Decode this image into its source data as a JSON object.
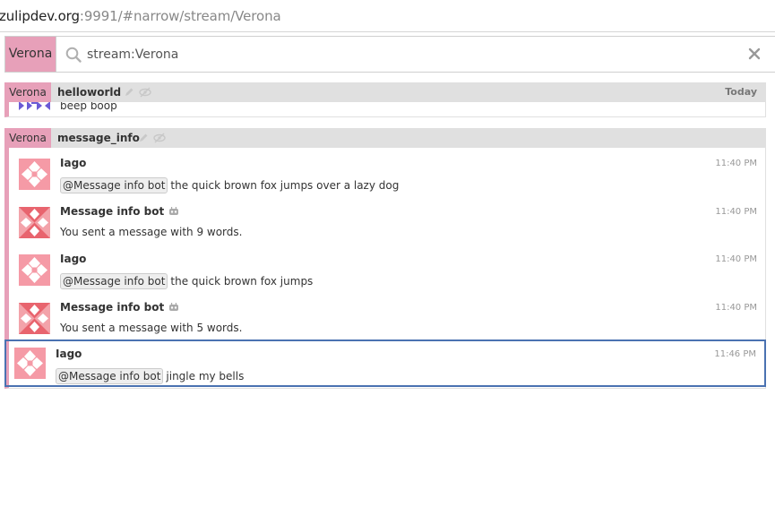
{
  "browser": {
    "url_host": "zulipdev.org",
    "url_rest": ":9991/#narrow/stream/Verona"
  },
  "search": {
    "stream_pill": "Verona",
    "query": "stream:Verona"
  },
  "recipient_bars": [
    {
      "stream": "Verona",
      "topic": "helloworld",
      "date": "Today"
    },
    {
      "stream": "Verona",
      "topic": "message_info",
      "date": ""
    }
  ],
  "first_group": {
    "partial_message": "beep boop"
  },
  "messages": [
    {
      "sender": "Iago",
      "is_bot": false,
      "time": "11:40 PM",
      "mention": "@Message info bot",
      "text": "the quick brown fox jumps over a lazy dog"
    },
    {
      "sender": "Message info bot",
      "is_bot": true,
      "time": "11:40 PM",
      "mention": "",
      "text": "You sent a message with 9 words."
    },
    {
      "sender": "Iago",
      "is_bot": false,
      "time": "11:40 PM",
      "mention": "@Message info bot",
      "text": "the quick brown fox jumps"
    },
    {
      "sender": "Message info bot",
      "is_bot": true,
      "time": "11:40 PM",
      "mention": "",
      "text": "You sent a message with 5 words."
    },
    {
      "sender": "Iago",
      "is_bot": false,
      "time": "11:46 PM",
      "mention": "@Message info bot",
      "text": "jingle my bells",
      "selected": true
    }
  ],
  "colors": {
    "stream_verona": "#e7a0b9",
    "selected_border": "#4a72b1",
    "recipient_bar": "#e0e0e0",
    "avatar_iago": "#f59aa6",
    "avatar_bot": "#e8646e"
  },
  "icons": {
    "search": "search-icon",
    "clear": "close-icon",
    "edit_topic": "pencil-icon",
    "mute_topic": "eye-slash-icon",
    "bot": "robot-icon"
  }
}
